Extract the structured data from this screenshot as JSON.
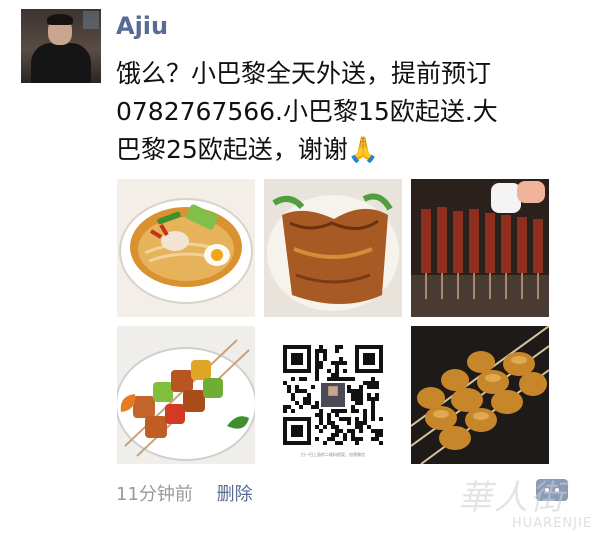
{
  "post": {
    "author": "Ajiu",
    "text": "饿么？小巴黎全天外送，提前预订\n0782767566.小巴黎15欧起送.大\n巴黎25欧起送，谢谢🙏",
    "timestamp": "11分钟前",
    "delete_label": "删除"
  },
  "images": [
    {
      "name": "noodle-soup-photo",
      "kind": "photo"
    },
    {
      "name": "roast-duck-photo",
      "kind": "photo"
    },
    {
      "name": "grill-skewers-photo",
      "kind": "photo"
    },
    {
      "name": "vegetable-skewers-photo",
      "kind": "photo"
    },
    {
      "name": "wechat-qr-code",
      "kind": "qr",
      "caption": "扫一扫上面的二维码图案，加我微信"
    },
    {
      "name": "chicken-skewers-photo",
      "kind": "photo"
    }
  ],
  "icons": {
    "comment": "comment-icon"
  },
  "watermark": {
    "logo_text": "華人街",
    "site_text": "HUARENJIE"
  },
  "colors": {
    "name_link": "#586b95",
    "time": "#9a9a9a",
    "comment_button": "#8a9ab9"
  }
}
